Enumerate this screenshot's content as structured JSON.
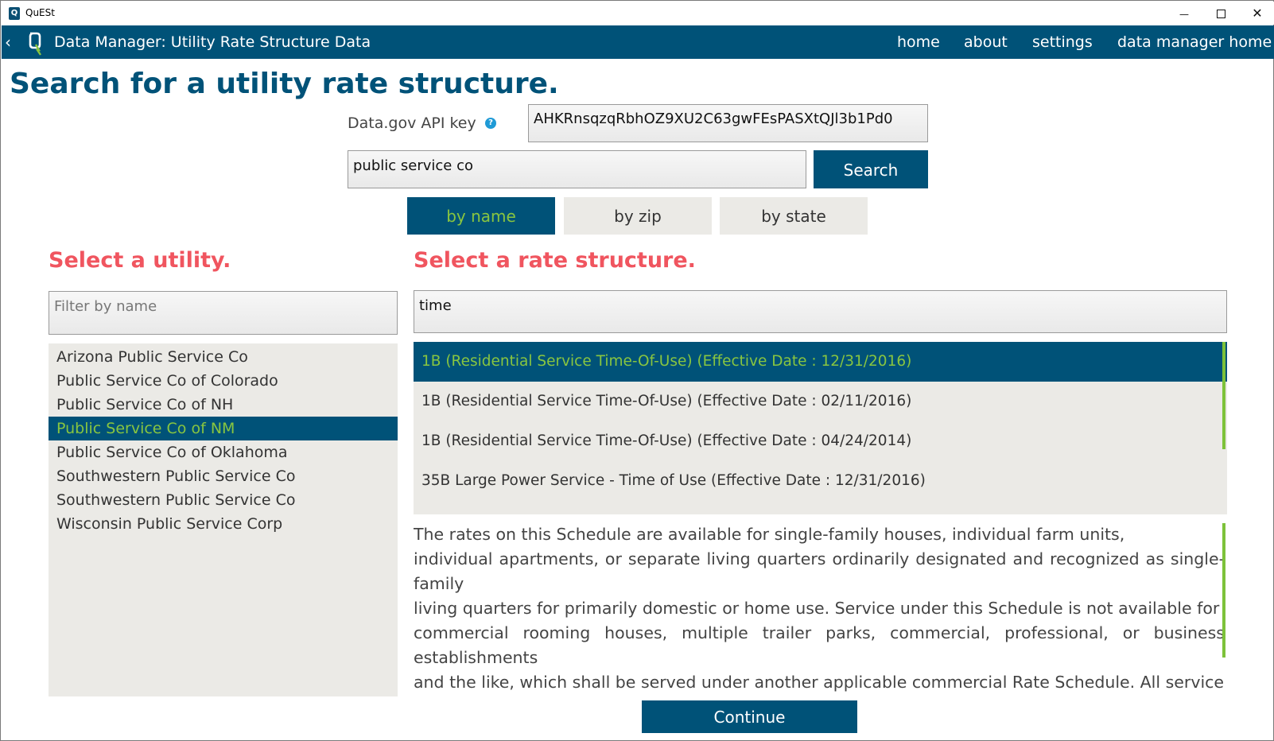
{
  "window": {
    "title": "QuESt",
    "app_icon_letter": "Q",
    "min_glyph": "—",
    "close_glyph": "✕"
  },
  "header": {
    "back_glyph": "‹",
    "title": "Data Manager: Utility Rate Structure Data",
    "nav": {
      "home": "home",
      "about": "about",
      "settings": "settings",
      "dm_home": "data manager home"
    }
  },
  "page": {
    "title": "Search for a utility rate structure."
  },
  "api": {
    "label": "Data.gov API key",
    "help_glyph": "?",
    "value": "AHKRnsqzqRbhOZ9XU2C63gwFEsPASXtQJl3b1Pd0"
  },
  "search": {
    "value": "public service co",
    "button_label": "Search",
    "modes": [
      "by name",
      "by zip",
      "by state"
    ],
    "active_mode": "by name"
  },
  "utility": {
    "heading": "Select a utility.",
    "filter_placeholder": "Filter by name",
    "items": [
      "Arizona Public Service Co",
      "Public Service Co of Colorado",
      "Public Service Co of NH",
      "Public Service Co of NM",
      "Public Service Co of Oklahoma",
      "Southwestern Public Service Co",
      "Southwestern Public Service Co",
      "Wisconsin Public Service Corp"
    ],
    "selected_index": 3
  },
  "rate": {
    "heading": "Select a rate structure.",
    "filter_value": "time",
    "items": [
      "1B (Residential Service Time-Of-Use) (Effective Date : 12/31/2016)",
      "1B (Residential Service Time-Of-Use) (Effective Date : 02/11/2016)",
      "1B (Residential Service Time-Of-Use) (Effective Date : 04/24/2014)",
      "35B Large Power Service - Time of Use (Effective Date : 12/31/2016)"
    ],
    "selected_index": 0,
    "description": [
      "The rates on this Schedule are available for single-family houses, individual farm units,",
      "individual apartments, or separate living quarters ordinarily designated and recognized as single-family",
      "living quarters for primarily domestic or home use. Service under this Schedule is not available for",
      "commercial rooming houses, multiple trailer parks, commercial, professional, or business establishments",
      "and the like, which shall be served under another applicable commercial Rate Schedule. All service"
    ]
  },
  "continue_label": "Continue",
  "colors": {
    "primary": "#005278",
    "accent_green": "#88c540",
    "heading_red": "#f0555f",
    "list_bg": "#ebeae6"
  }
}
